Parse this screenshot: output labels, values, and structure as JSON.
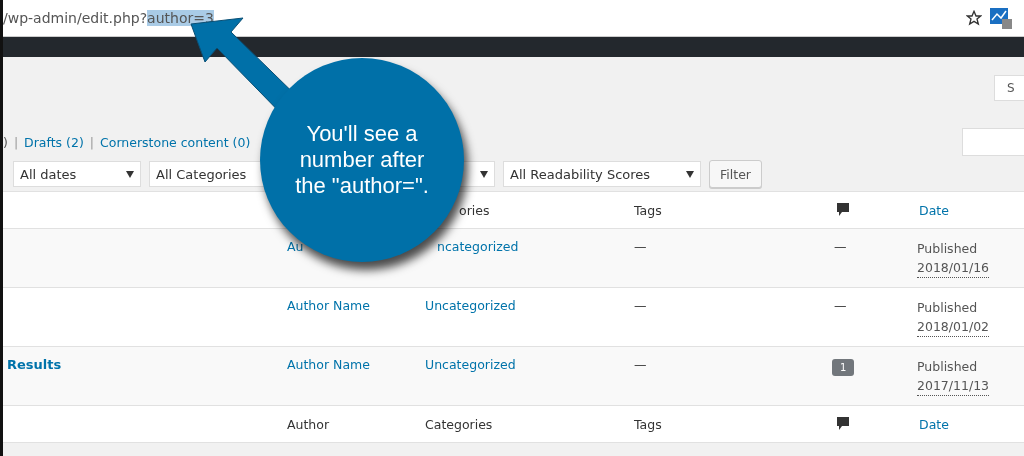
{
  "address_bar": {
    "url": "/wp-admin/edit.php?",
    "selection": "author=3"
  },
  "search_button": {
    "label": "S"
  },
  "status_links": [
    {
      "label": ")",
      "kind": "text"
    },
    {
      "label": "|",
      "kind": "separator"
    },
    {
      "label": "Drafts (2)",
      "kind": "link"
    },
    {
      "label": "|",
      "kind": "separator"
    },
    {
      "label": "Cornerstone content (0)",
      "kind": "link"
    }
  ],
  "filters": [
    {
      "kind": "select",
      "label": "All dates"
    },
    {
      "kind": "select",
      "label": "All Categories"
    },
    {
      "kind": "select"
    },
    {
      "kind": "select",
      "label": "All Readability Scores"
    }
  ],
  "filter_button": "Filter",
  "table": {
    "header": [
      {
        "kind": "blank"
      },
      {
        "kind": "blank"
      },
      {
        "kind": "text",
        "label": "ories"
      },
      {
        "kind": "text",
        "label": "Tags"
      },
      {
        "kind": "icon"
      },
      {
        "kind": "link",
        "label": "Date"
      }
    ],
    "footer": [
      {
        "kind": "blank"
      },
      {
        "kind": "text",
        "label": "Author"
      },
      {
        "kind": "text",
        "label": "Categories"
      },
      {
        "kind": "text",
        "label": "Tags"
      },
      {
        "kind": "icon"
      },
      {
        "kind": "link",
        "label": "Date"
      }
    ],
    "rows": [
      {
        "author": "Au",
        "categories": "ncategorized",
        "tags": "—",
        "comments": {
          "kind": "dash",
          "text": "—"
        },
        "status": "Published",
        "date": "2018/01/16"
      },
      {
        "author": "Author Name",
        "categories": "Uncategorized",
        "tags": "—",
        "comments": {
          "kind": "dash",
          "text": "—"
        },
        "status": "Published",
        "date": "2018/01/02"
      },
      {
        "title": "Results",
        "author": "Author Name",
        "categories": "Uncategorized",
        "tags": "—",
        "comments": {
          "kind": "count",
          "text": "1"
        },
        "status": "Published",
        "date": "2017/11/13"
      }
    ]
  },
  "callout": {
    "text": "You'll see a number after the \"author=\"."
  }
}
